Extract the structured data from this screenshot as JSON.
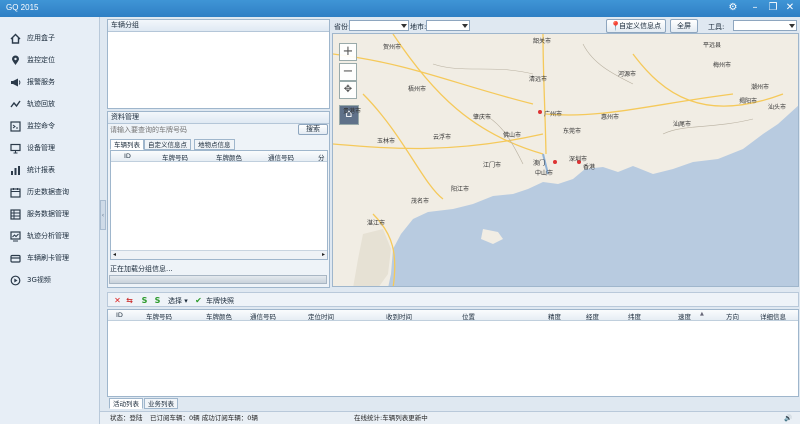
{
  "window": {
    "title": "GQ 2015"
  },
  "sidebar": {
    "items": [
      {
        "label": "应用盒子",
        "icon": "home-icon"
      },
      {
        "label": "监控定位",
        "icon": "location-pin-icon"
      },
      {
        "label": "报警服务",
        "icon": "alarm-megaphone-icon"
      },
      {
        "label": "轨迹回放",
        "icon": "track-line-icon"
      },
      {
        "label": "监控命令",
        "icon": "monitor-command-icon"
      },
      {
        "label": "设备管理",
        "icon": "device-monitor-icon"
      },
      {
        "label": "统计报表",
        "icon": "bar-chart-icon"
      },
      {
        "label": "历史数据查询",
        "icon": "calendar-icon"
      },
      {
        "label": "服务数据管理",
        "icon": "data-grid-icon"
      },
      {
        "label": "轨迹分析管理",
        "icon": "analysis-icon"
      },
      {
        "label": "车辆刷卡管理",
        "icon": "card-reader-icon"
      },
      {
        "label": "3G视频",
        "icon": "video-3g-icon"
      }
    ]
  },
  "vehicle_group": {
    "title": "车辆分组"
  },
  "resource": {
    "title": "资料管理",
    "search_placeholder": "请输入要查询的车牌号码",
    "search_button": "搜索",
    "tabs": [
      "车辆列表",
      "自定义信息点",
      "地物点信息"
    ],
    "columns": [
      "ID",
      "车牌号码",
      "车牌颜色",
      "通信号码",
      "分"
    ],
    "loading": "正在加载分组信息..."
  },
  "map_toolbar": {
    "province_label": "省份:",
    "city_label": "地市:",
    "custom_poi_button": "自定义信息点",
    "fullscreen_button": "全屏",
    "tools_label": "工具:"
  },
  "map": {
    "labels": [
      "贺州市",
      "韶关市",
      "平远县",
      "梧州市",
      "清远市",
      "梅州市",
      "河源市",
      "潮州市",
      "贵港市",
      "肇庆市",
      "广州市",
      "东莞市",
      "惠州市",
      "汕尾市",
      "玉林市",
      "佛山市",
      "江门市",
      "中山市",
      "深圳市",
      "香港",
      "茂名市",
      "阳江市",
      "湛江市",
      "澳门",
      "云浮市",
      "汕头市",
      "揭阳市"
    ]
  },
  "bottom_toolbar": {
    "select_label": "选择",
    "snapshot_label": "车牌快照"
  },
  "bottom_grid": {
    "columns": [
      "ID",
      "车牌号码",
      "车牌颜色",
      "通信号码",
      "定位时间",
      "收到时间",
      "位置",
      "精度",
      "经度",
      "纬度",
      "速度",
      "方向",
      "详细信息"
    ]
  },
  "bottom_tabs": [
    "活动列表",
    "业务列表"
  ],
  "status": {
    "state": "状态：登陆",
    "subscription": "已订阅车辆：0辆 成功订阅车辆：0辆",
    "online": "在线统计:车辆列表更新中"
  },
  "colors": {
    "titlebar": "#3585c9",
    "map_sea": "#b8cbe0",
    "map_land": "#f1ede4",
    "road": "#f5c95a"
  }
}
